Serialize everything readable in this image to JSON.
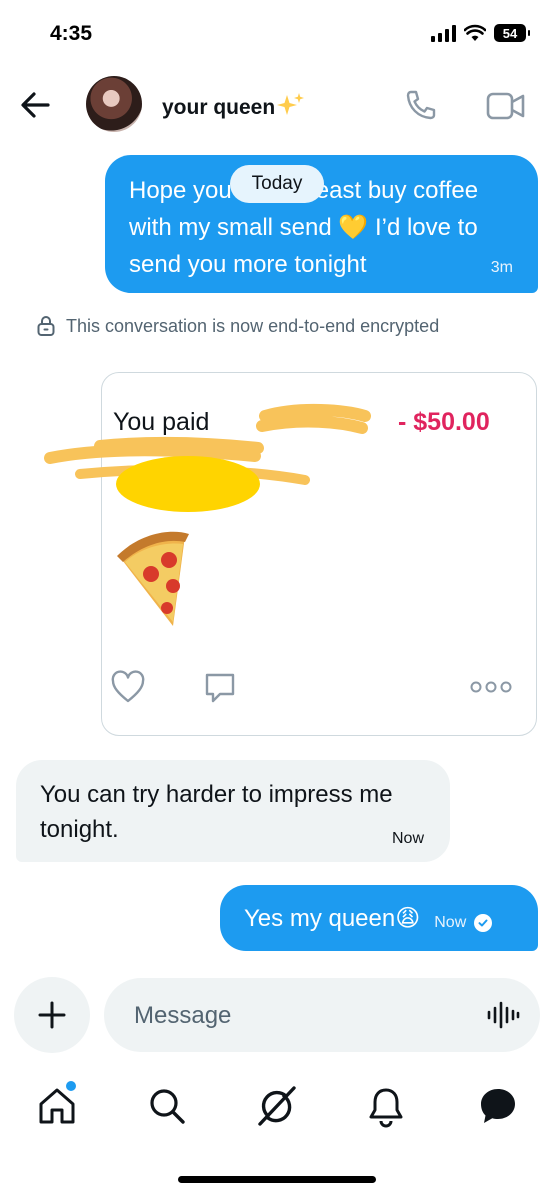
{
  "status_bar": {
    "time": "4:35",
    "battery": "54"
  },
  "header": {
    "contact_name": "your queen",
    "back_icon": "arrow-left-icon",
    "call_icon": "phone-icon",
    "video_icon": "video-camera-icon"
  },
  "messages": {
    "outgoing_1": {
      "text": "Hope you can at least buy coffee with my small send 💛 I’d love to send you more tonight",
      "time": "3m"
    },
    "date_chip": "Today",
    "encryption_notice": "This conversation is now end-to-end encrypted",
    "payment_card": {
      "description": "You paid",
      "amount": "- $50.00",
      "emoji": "pizza"
    },
    "incoming_1": {
      "text": "You can try harder to impress me tonight.",
      "time": "Now"
    },
    "outgoing_2": {
      "text": "Yes my queen😩",
      "time": "Now"
    }
  },
  "composer": {
    "placeholder": "Message"
  },
  "bottom_nav": [
    "home-icon",
    "search-icon",
    "grok-icon",
    "notifications-icon",
    "messages-icon"
  ],
  "colors": {
    "accent": "#1d9bf0",
    "bubble_in": "#eff3f4",
    "amount": "#e0245e"
  }
}
